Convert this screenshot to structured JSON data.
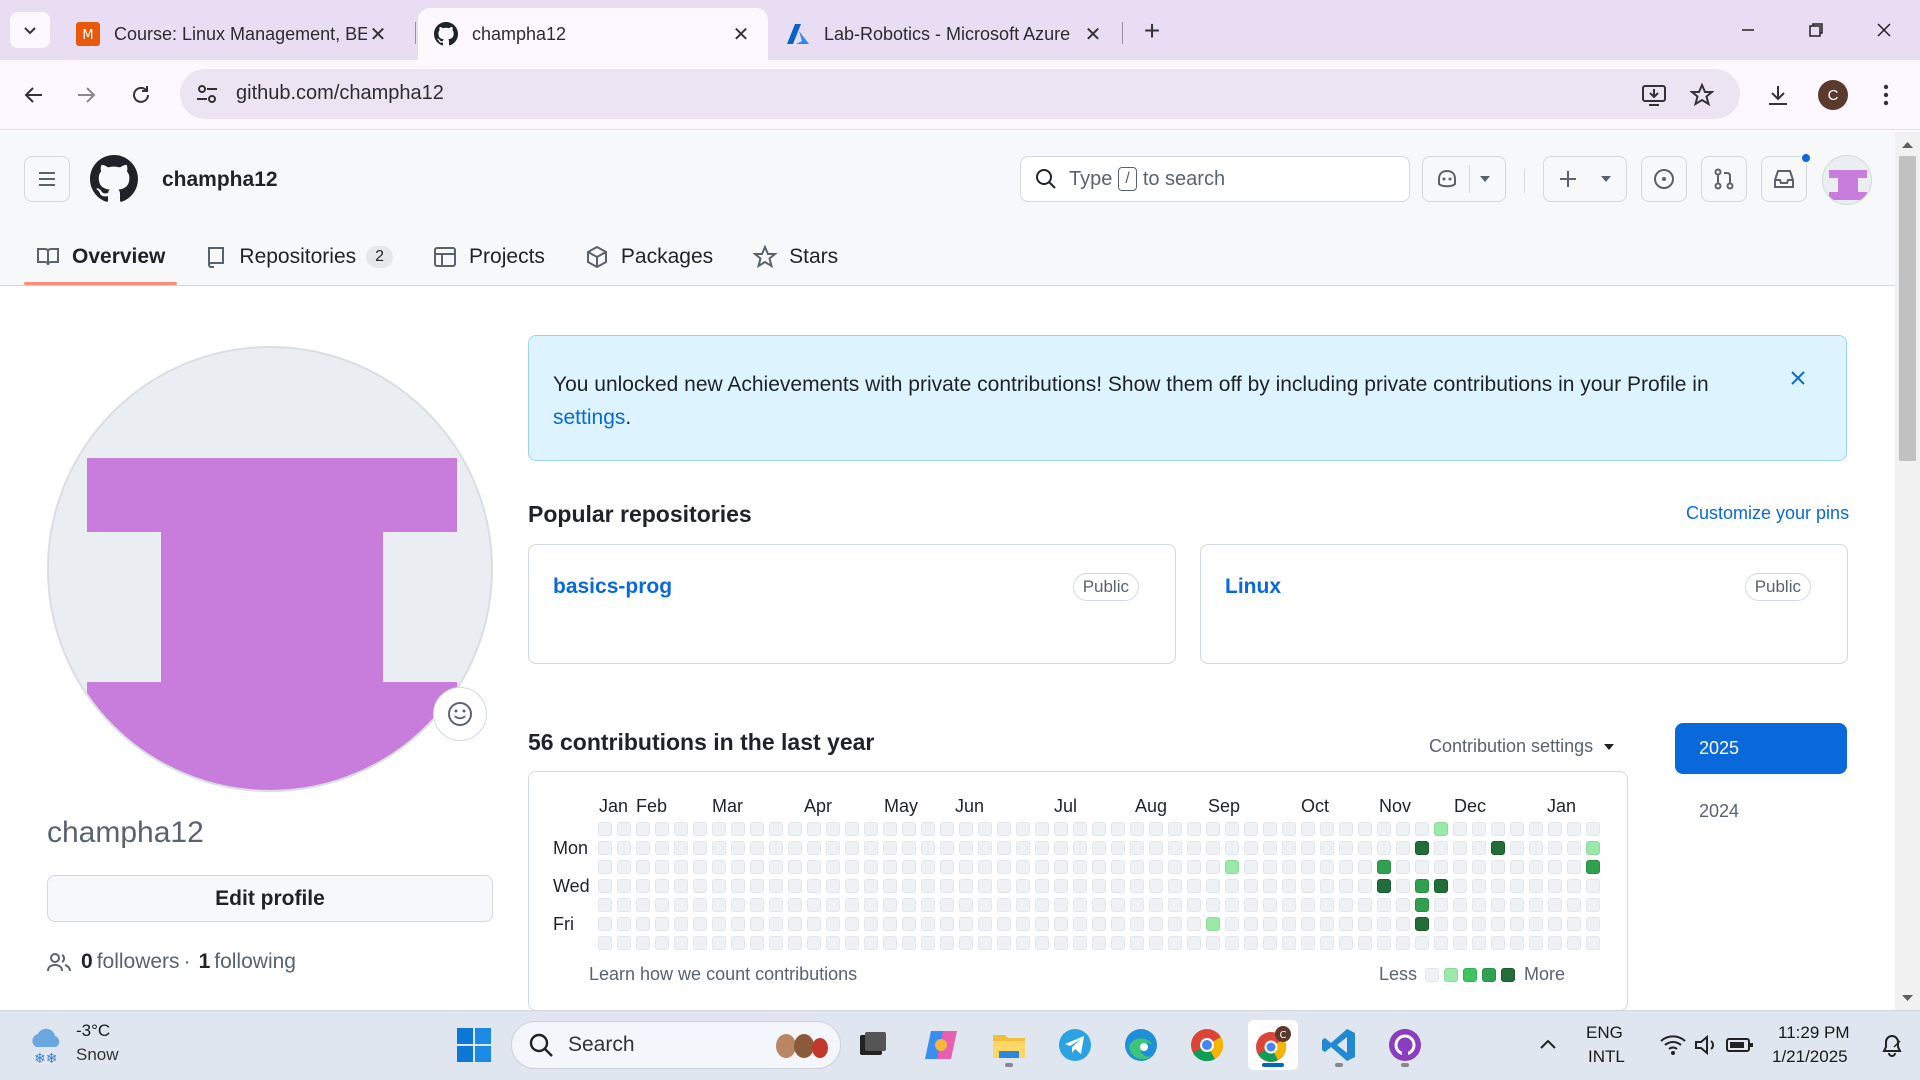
{
  "browser": {
    "tabs": [
      {
        "title": "Course: Linux Management, BEI",
        "icon": "moodle-icon",
        "active": false
      },
      {
        "title": "champha12",
        "icon": "github-icon",
        "active": true
      },
      {
        "title": "Lab-Robotics - Microsoft Azure",
        "icon": "azure-icon",
        "active": false
      }
    ],
    "url": "github.com/champha12",
    "profile_initial": "C"
  },
  "github": {
    "username": "champha12",
    "search_prefix": "Type",
    "search_key": "/",
    "search_suffix": "to search",
    "nav": [
      {
        "label": "Overview",
        "icon": "book-icon",
        "selected": true
      },
      {
        "label": "Repositories",
        "icon": "repo-icon",
        "count": "2"
      },
      {
        "label": "Projects",
        "icon": "table-icon"
      },
      {
        "label": "Packages",
        "icon": "package-icon"
      },
      {
        "label": "Stars",
        "icon": "star-icon"
      }
    ]
  },
  "profile": {
    "login": "champha12",
    "edit_label": "Edit profile",
    "followers_count": "0",
    "followers_label": "followers",
    "separator": "·",
    "following_count": "1",
    "following_label": "following"
  },
  "flash": {
    "text": "You unlocked new Achievements with private contributions! Show them off by including private contributions in your Profile in ",
    "link": "settings",
    "suffix": "."
  },
  "popular": {
    "title": "Popular repositories",
    "customize": "Customize your pins",
    "repos": [
      {
        "name": "basics-prog",
        "visibility": "Public"
      },
      {
        "name": "Linux",
        "visibility": "Public"
      }
    ]
  },
  "contributions": {
    "title": "56 contributions in the last year",
    "settings_label": "Contribution settings",
    "months": [
      "Jan",
      "Feb",
      "Mar",
      "Apr",
      "May",
      "Jun",
      "Jul",
      "Aug",
      "Sep",
      "Oct",
      "Nov",
      "Dec",
      "Jan"
    ],
    "days": [
      "Mon",
      "Wed",
      "Fri"
    ],
    "learn": "Learn how we count contributions",
    "less": "Less",
    "more": "More",
    "weeks": 53,
    "active_cells": [
      {
        "week": 32,
        "day": 5,
        "level": 1
      },
      {
        "week": 33,
        "day": 2,
        "level": 1
      },
      {
        "week": 41,
        "day": 2,
        "level": 3
      },
      {
        "week": 41,
        "day": 3,
        "level": 4
      },
      {
        "week": 43,
        "day": 1,
        "level": 4
      },
      {
        "week": 43,
        "day": 3,
        "level": 3
      },
      {
        "week": 43,
        "day": 4,
        "level": 3
      },
      {
        "week": 43,
        "day": 5,
        "level": 4
      },
      {
        "week": 44,
        "day": 0,
        "level": 1
      },
      {
        "week": 44,
        "day": 3,
        "level": 4
      },
      {
        "week": 47,
        "day": 1,
        "level": 4
      },
      {
        "week": 52,
        "day": 1,
        "level": 1
      },
      {
        "week": 52,
        "day": 2,
        "level": 3
      }
    ],
    "years": [
      "2025",
      "2024"
    ],
    "selected_year": "2025"
  },
  "taskbar": {
    "temperature": "-3°C",
    "condition": "Snow",
    "search_label": "Search",
    "language": "ENG",
    "layout": "INTL",
    "time": "11:29 PM",
    "date": "1/21/2025"
  },
  "colors": {
    "accent": "#0969da",
    "avatar": "#c87ddc",
    "contrib_levels": [
      "#eff2f5",
      "#9be9a8",
      "#40c463",
      "#30a14e",
      "#216e39"
    ]
  }
}
